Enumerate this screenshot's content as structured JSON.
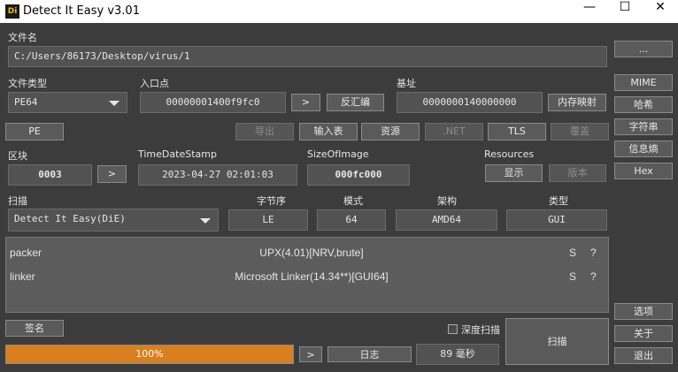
{
  "window": {
    "title": "Detect It Easy v3.01",
    "icon_text": "Di",
    "minimize": "—",
    "maximize": "☐",
    "close": "✕"
  },
  "file": {
    "label": "文件名",
    "path": "C:/Users/86173/Desktop/virus/1",
    "browse": "..."
  },
  "filetype": {
    "label": "文件类型",
    "value": "PE64"
  },
  "entry": {
    "label": "入口点",
    "value": "00000001400f9fc0",
    "go": ">",
    "disasm": "反汇编"
  },
  "base": {
    "label": "基址",
    "value": "0000000140000000",
    "memmap": "内存映射"
  },
  "pe_button": "PE",
  "tool_buttons": {
    "export": "导出",
    "import": "输入表",
    "resource": "资源",
    "net": ".NET",
    "tls": "TLS",
    "overlay": "覆盖"
  },
  "sections": {
    "label": "区块",
    "value": "0003",
    "go": ">"
  },
  "timestamp": {
    "label": "TimeDateStamp",
    "value": "2023-04-27 02:01:03"
  },
  "sizeofimage": {
    "label": "SizeOfImage",
    "value": "000fc000"
  },
  "resources": {
    "label": "Resources",
    "show": "显示",
    "version": "版本"
  },
  "scan": {
    "label": "扫描",
    "engine": "Detect It Easy(DiE)",
    "endian_label": "字节序",
    "endian": "LE",
    "mode_label": "模式",
    "mode": "64",
    "arch_label": "架构",
    "arch": "AMD64",
    "type_label": "类型",
    "type": "GUI"
  },
  "results": [
    {
      "kind": "packer",
      "name": "UPX(4.01)[NRV,brute]",
      "s": "S",
      "q": "?"
    },
    {
      "kind": "linker",
      "name": "Microsoft Linker(14.34**)[GUI64]",
      "s": "S",
      "q": "?"
    }
  ],
  "side_buttons": {
    "mime": "MIME",
    "hash": "哈希",
    "strings": "字符串",
    "entropy": "信息熵",
    "hex": "Hex",
    "options": "选项",
    "about": "关于",
    "exit": "退出"
  },
  "bottom": {
    "signature": "签名",
    "deep_scan": "深度扫描",
    "deep_scan_checked": false,
    "progress_text": "100%",
    "progress": 1.0,
    "go": ">",
    "log": "日志",
    "time": "89 毫秒",
    "scan_button": "扫描"
  },
  "colors": {
    "accent": "#d97f1f",
    "background": "#3c3c3c"
  }
}
